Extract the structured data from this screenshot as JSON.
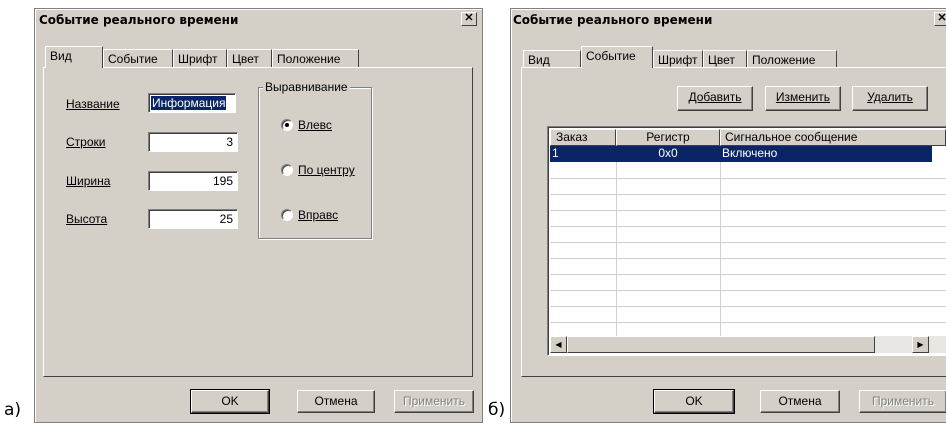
{
  "captions": {
    "a": "а)",
    "b": "б)"
  },
  "dialog_a": {
    "title": "Событие реального времени",
    "tabs": [
      "Вид",
      "Событие",
      "Шрифт",
      "Цвет",
      "Положение"
    ],
    "fields": {
      "name_label": "Название",
      "name_value": "Информация",
      "rows_label": "Строки",
      "rows_value": "3",
      "width_label": "Ширина",
      "width_value": "195",
      "height_label": "Высота",
      "height_value": "25"
    },
    "align_group": {
      "title": "Выравнивание",
      "options": [
        "Влевс",
        "По центру",
        "Вправс"
      ],
      "selected": "Влевс"
    },
    "buttons": {
      "ok": "OK",
      "cancel": "Отмена",
      "apply": "Применить"
    }
  },
  "dialog_b": {
    "title": "Событие реального времени",
    "tabs": [
      "Вид",
      "Событие",
      "Шрифт",
      "Цвет",
      "Положение"
    ],
    "actions": {
      "add": "Добавить",
      "edit": "Изменить",
      "delete": "Удалить"
    },
    "table": {
      "columns": [
        "Заказ",
        "Регистр",
        "Сигнальное сообщение"
      ],
      "rows": [
        {
          "order": "1",
          "register": "0x0",
          "message": "Включено"
        }
      ]
    },
    "buttons": {
      "ok": "OK",
      "cancel": "Отмена",
      "apply": "Применить"
    }
  },
  "colors": {
    "face": "#d4d0c8",
    "selection": "#0a246a",
    "shadow": "#808080"
  }
}
